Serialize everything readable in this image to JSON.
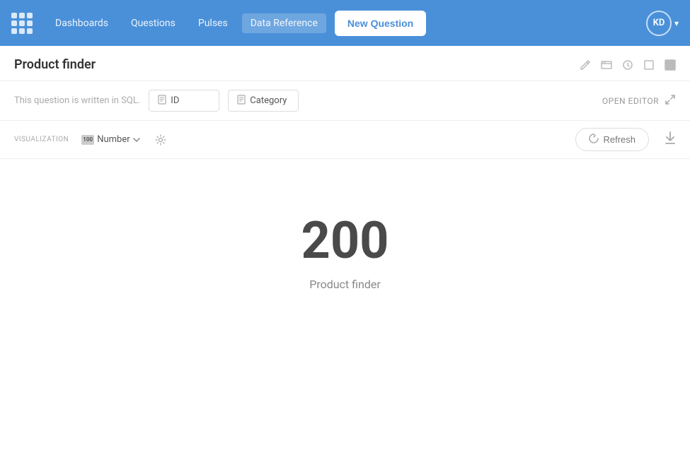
{
  "navbar": {
    "logo_label": "Metabase",
    "links": [
      {
        "label": "Dashboards",
        "active": false
      },
      {
        "label": "Questions",
        "active": false
      },
      {
        "label": "Pulses",
        "active": false
      },
      {
        "label": "Data Reference",
        "active": true
      }
    ],
    "new_question_label": "New Question",
    "avatar_initials": "KD"
  },
  "question": {
    "title": "Product finder",
    "sql_label": "This question is written in SQL.",
    "params": [
      {
        "icon": "🗂",
        "label": "ID"
      },
      {
        "icon": "🗂",
        "label": "Category"
      }
    ],
    "open_editor_label": "OPEN EDITOR"
  },
  "visualization": {
    "label": "VISUALIZATION",
    "type": "Number",
    "refresh_label": "Refresh"
  },
  "result": {
    "number": "200",
    "label": "Product finder"
  },
  "icons": {
    "x_icon": "✕",
    "embed_icon": "⊡",
    "history_icon": "⏱",
    "share_icon": "□",
    "bookmark_icon": "▣",
    "expand_icon": "⤢",
    "refresh_spin": "↻",
    "download_arrow": "↓",
    "gear_icon": "⚙",
    "caret_down": "▾",
    "number_label": "100"
  }
}
